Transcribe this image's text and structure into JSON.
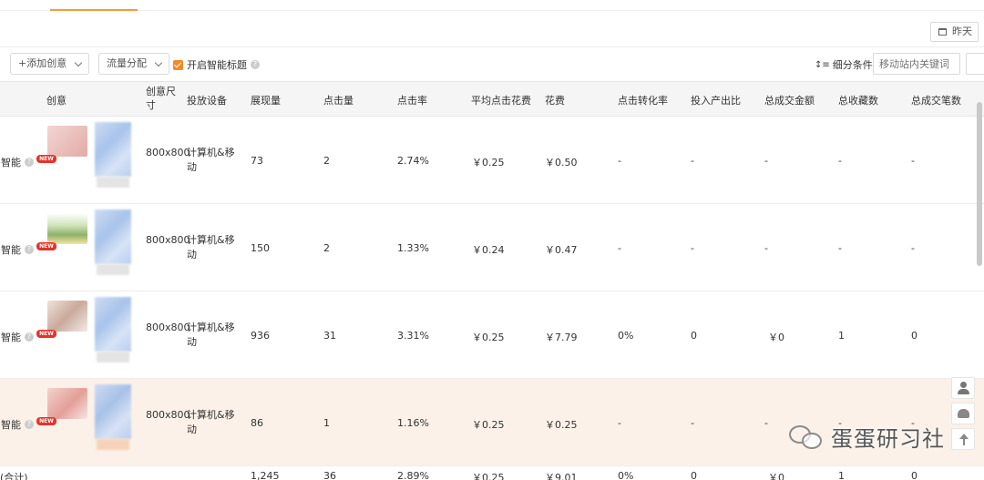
{
  "header": {
    "date_label": "昨天"
  },
  "toolbar": {
    "add_creative": "+添加创意",
    "traffic_split": "流量分配",
    "smart_title": "开启智能标题",
    "filter_label": "细分条件:",
    "keyword_placeholder": "移动站内关键词"
  },
  "table": {
    "columns": [
      "创意",
      "创意尺寸",
      "投放设备",
      "展现量",
      "点击量",
      "点击率",
      "平均点击花费",
      "花费",
      "点击转化率",
      "投入产出比",
      "总成交金额",
      "总收藏数",
      "总成交笔数"
    ],
    "rows": [
      {
        "smart": "智能",
        "size": "800x800",
        "device": "计算机&移动",
        "impressions": "73",
        "clicks": "2",
        "ctr": "2.74%",
        "cpc": "￥0.25",
        "cost": "￥0.50",
        "cvr": "-",
        "roi": "-",
        "gmv": "-",
        "favs": "-",
        "orders": "-",
        "thumb_color": "#e9c3c0"
      },
      {
        "smart": "智能",
        "size": "800x800",
        "device": "计算机&移动",
        "impressions": "150",
        "clicks": "2",
        "ctr": "1.33%",
        "cpc": "￥0.24",
        "cost": "￥0.47",
        "cvr": "-",
        "roi": "-",
        "gmv": "-",
        "favs": "-",
        "orders": "-",
        "thumb_color": "#b9d3a7"
      },
      {
        "smart": "智能",
        "size": "800x800",
        "device": "计算机&移动",
        "impressions": "936",
        "clicks": "31",
        "ctr": "3.31%",
        "cpc": "￥0.25",
        "cost": "￥7.79",
        "cvr": "0%",
        "roi": "0",
        "gmv": "￥0",
        "favs": "1",
        "orders": "0",
        "thumb_color": "#e2cdbf"
      },
      {
        "smart": "智能",
        "size": "800x800",
        "device": "计算机&移动",
        "impressions": "86",
        "clicks": "1",
        "ctr": "1.16%",
        "cpc": "￥0.25",
        "cost": "￥0.25",
        "cvr": "-",
        "roi": "-",
        "gmv": "-",
        "favs": "-",
        "orders": "-",
        "thumb_color": "#e8b9b4"
      }
    ],
    "total": {
      "label": "(合计)",
      "impressions": "1,245",
      "clicks": "36",
      "ctr": "2.89%",
      "cpc": "￥0.25",
      "cost": "￥9.01",
      "cvr": "0%",
      "roi": "0",
      "gmv": "￥0",
      "favs": "1",
      "orders": "0"
    }
  },
  "badge": "NEW",
  "watermark": "蛋蛋研习社",
  "colors": {
    "accent": "#f28c28",
    "highlight_row": "#fbf1e8",
    "badge": "#e6332a"
  }
}
